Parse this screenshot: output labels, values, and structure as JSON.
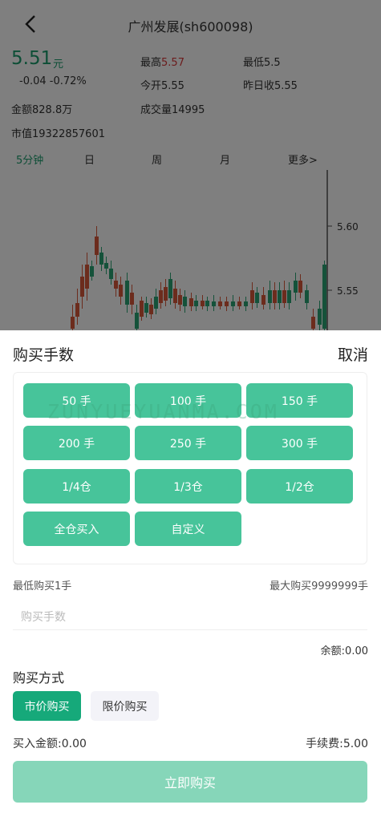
{
  "stock": {
    "title": "广州发展(sh600098)",
    "price": "5.51",
    "price_unit": "元",
    "change": "-0.04  -0.72%",
    "high_label": "最高",
    "high_value": "5.57",
    "low": "最低5.5",
    "open": "今开5.55",
    "prev_close": "昨日收5.55",
    "amount": "金额828.8万",
    "volume": "成交量14995",
    "market_cap": "市值19322857601"
  },
  "periods": {
    "min5": "5分钟",
    "day": "日",
    "week": "周",
    "month": "月",
    "more": "更多>"
  },
  "chart_data": {
    "type": "candlestick",
    "y_ticks": [
      "5.60",
      "5.55"
    ]
  },
  "colors": {
    "up": "#d9583a",
    "down": "#2aa575",
    "accent": "#47c49a",
    "primary": "#16a97a",
    "buy_button": "#86d6b9"
  },
  "sheet": {
    "title": "购买手数",
    "cancel": "取消",
    "watermark": "ZUNYUEYUANMA.COM",
    "qty_options": [
      "50 手",
      "100 手",
      "150 手",
      "200 手",
      "250 手",
      "300 手",
      "1/4仓",
      "1/3仓",
      "1/2仓",
      "全仓买入",
      "自定义"
    ],
    "min_buy": "最低购买1手",
    "max_buy": "最大购买9999999手",
    "qty_placeholder": "购买手数",
    "balance": "余额:0.00",
    "method_title": "购买方式",
    "method_market": "市价购买",
    "method_limit": "限价购买",
    "buy_amount": "买入金额:0.00",
    "fee": "手续费:5.00",
    "buy_now": "立即购买"
  }
}
